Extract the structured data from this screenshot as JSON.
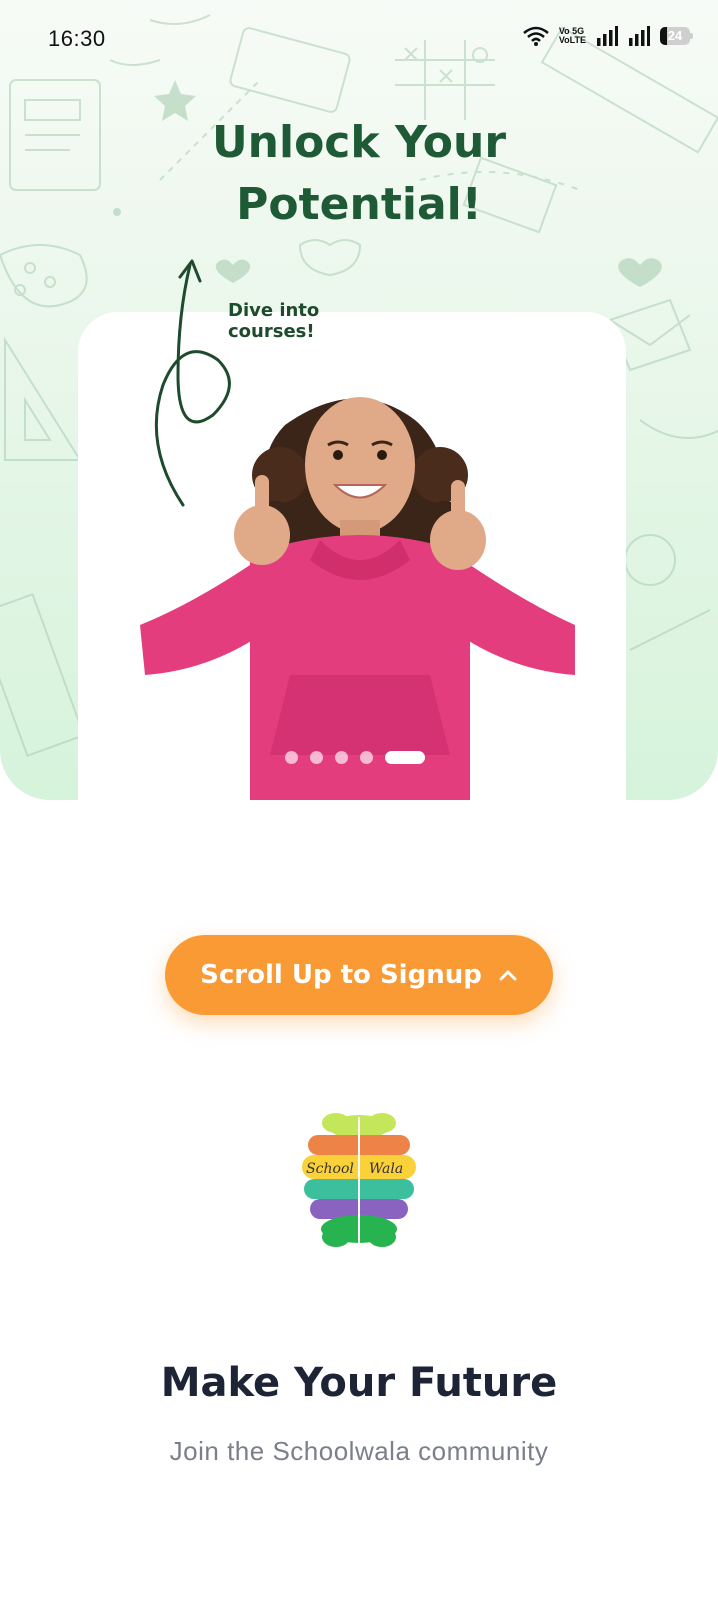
{
  "status_bar": {
    "time": "16:30",
    "network_label": "Vo 5G\nVoLTE",
    "battery": "24"
  },
  "hero": {
    "title_line1": "Unlock Your",
    "title_line2": "Potential!",
    "arrow_note": "Dive into\ncourses!",
    "carousel": {
      "total": 5,
      "active_index": 4
    }
  },
  "cta": {
    "label": "Scroll Up to Signup",
    "icon": "chevron-up-icon"
  },
  "logo": {
    "word1": "School",
    "word2": "Wala"
  },
  "main": {
    "title": "Make Your Future",
    "subtitle": "Join the Schoolwala community"
  },
  "colors": {
    "accent_orange": "#f99a34",
    "hero_title_green": "#1e5a35",
    "title_navy": "#1c2436",
    "subtitle_gray": "#7b7f8a"
  }
}
